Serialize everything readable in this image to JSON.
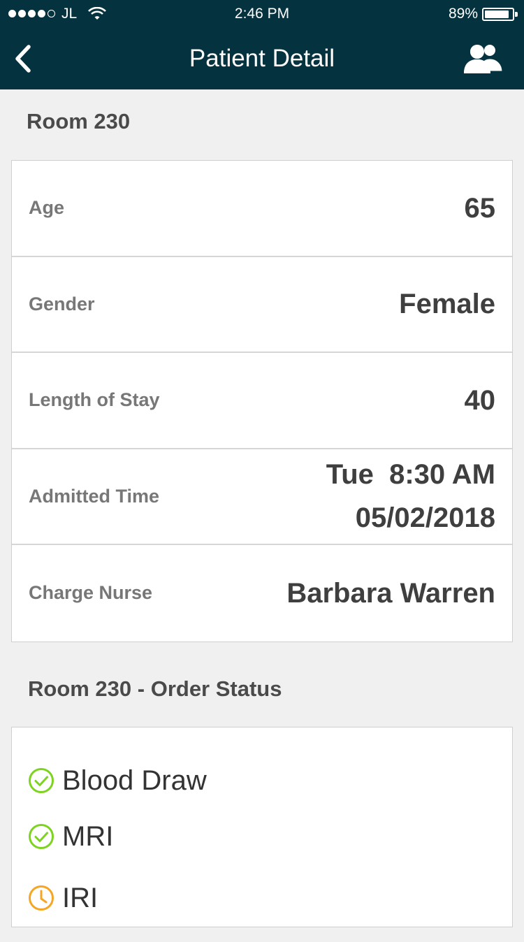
{
  "status_bar": {
    "carrier": "JL",
    "time": "2:46 PM",
    "battery": "89%",
    "battery_level": 0.89,
    "signal_bars": 4
  },
  "nav": {
    "title": "Patient Detail",
    "back_icon": "chevron-left-icon",
    "group_icon": "group-icon"
  },
  "patient": {
    "section_title": "Room 230",
    "rows": [
      {
        "label": "Age",
        "value": "65"
      },
      {
        "label": "Gender",
        "value": "Female"
      },
      {
        "label": "Length of Stay",
        "value": "40"
      },
      {
        "label": "Admitted Time",
        "value_line1": "Tue  8:30 AM",
        "value_line2": "05/02/2018"
      },
      {
        "label": "Charge Nurse",
        "value": "Barbara Warren"
      }
    ]
  },
  "orders": {
    "section_title": "Room 230 - Order Status",
    "items": [
      {
        "label": "Blood Draw",
        "status": "complete",
        "icon": "check-circle-icon",
        "color": "#7ed321"
      },
      {
        "label": "MRI",
        "status": "complete",
        "icon": "check-circle-icon",
        "color": "#7ed321"
      },
      {
        "label": "IRI",
        "status": "pending",
        "icon": "clock-icon",
        "color": "#f5a623"
      }
    ]
  },
  "colors": {
    "header_bg": "#05323f",
    "page_bg": "#f0f0f0",
    "complete": "#7ed321",
    "pending": "#f5a623"
  }
}
